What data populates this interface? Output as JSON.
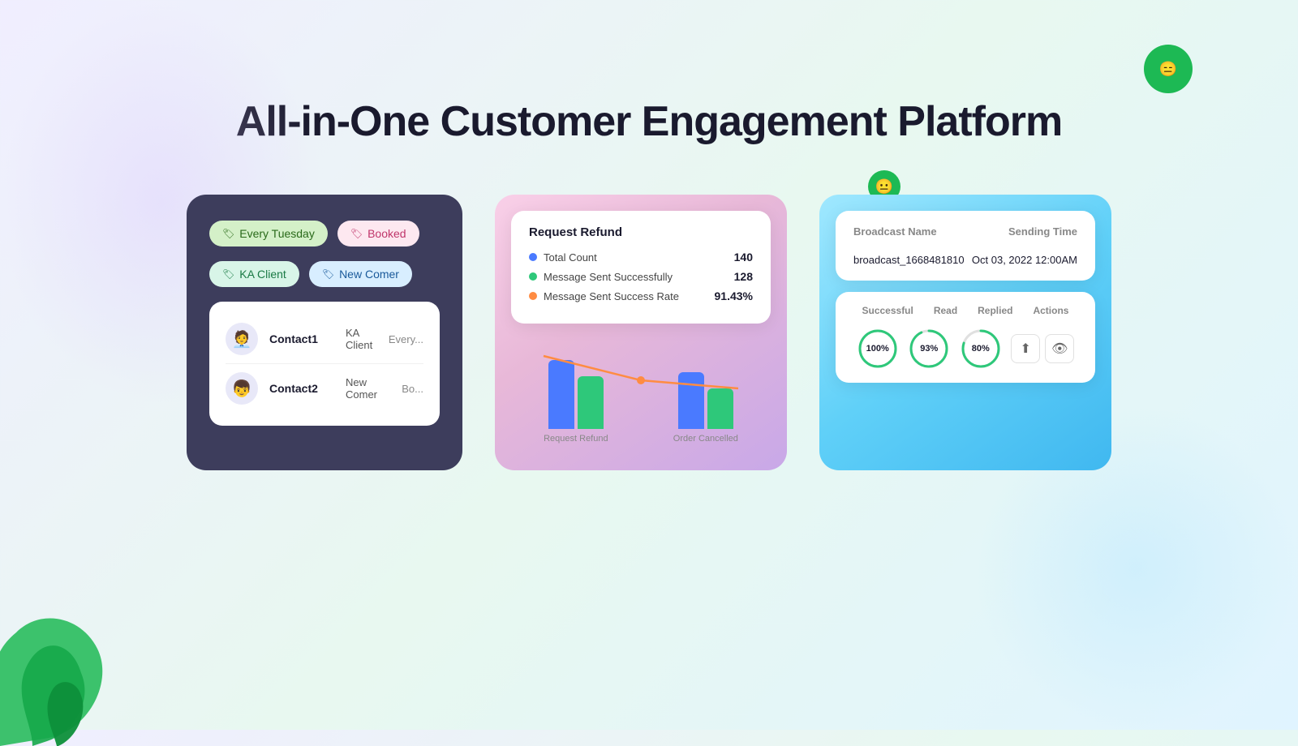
{
  "page": {
    "title": "All-in-One Customer Engagement Platform"
  },
  "deco": {
    "circle_large_face": "😑",
    "circle_small_face": "😐"
  },
  "card_contacts": {
    "tags": [
      {
        "label": "Every Tuesday",
        "style": "tuesday"
      },
      {
        "label": "Booked",
        "style": "booked"
      },
      {
        "label": "KA Client",
        "style": "ka"
      },
      {
        "label": "New Comer",
        "style": "newcomer"
      }
    ],
    "contacts": [
      {
        "name": "Contact1",
        "tag": "KA Client",
        "extra": "Every..."
      },
      {
        "name": "Contact2",
        "tag": "New Comer",
        "extra": "Bo..."
      }
    ]
  },
  "card_analytics": {
    "title": "Request Refund",
    "stats": [
      {
        "label": "Total Count",
        "value": "140",
        "dot": "blue"
      },
      {
        "label": "Message Sent Successfully",
        "value": "128",
        "dot": "green"
      },
      {
        "label": "Message Sent Success Rate",
        "value": "91.43%",
        "dot": "orange"
      }
    ],
    "chart": {
      "bars": [
        {
          "blue": 90,
          "green": 70,
          "label": "Request Refund"
        },
        {
          "blue": 75,
          "green": 55,
          "label": "Order Cancelled"
        }
      ]
    }
  },
  "card_broadcast": {
    "table": {
      "col1": "Broadcast Name",
      "col2": "Sending Time",
      "row_name": "broadcast_1668481810",
      "row_time": "Oct 03, 2022 12:00AM"
    },
    "stats": {
      "headers": [
        "Successful",
        "Read",
        "Replied",
        "Actions"
      ],
      "values": [
        "100%",
        "93%",
        "80%"
      ]
    }
  }
}
